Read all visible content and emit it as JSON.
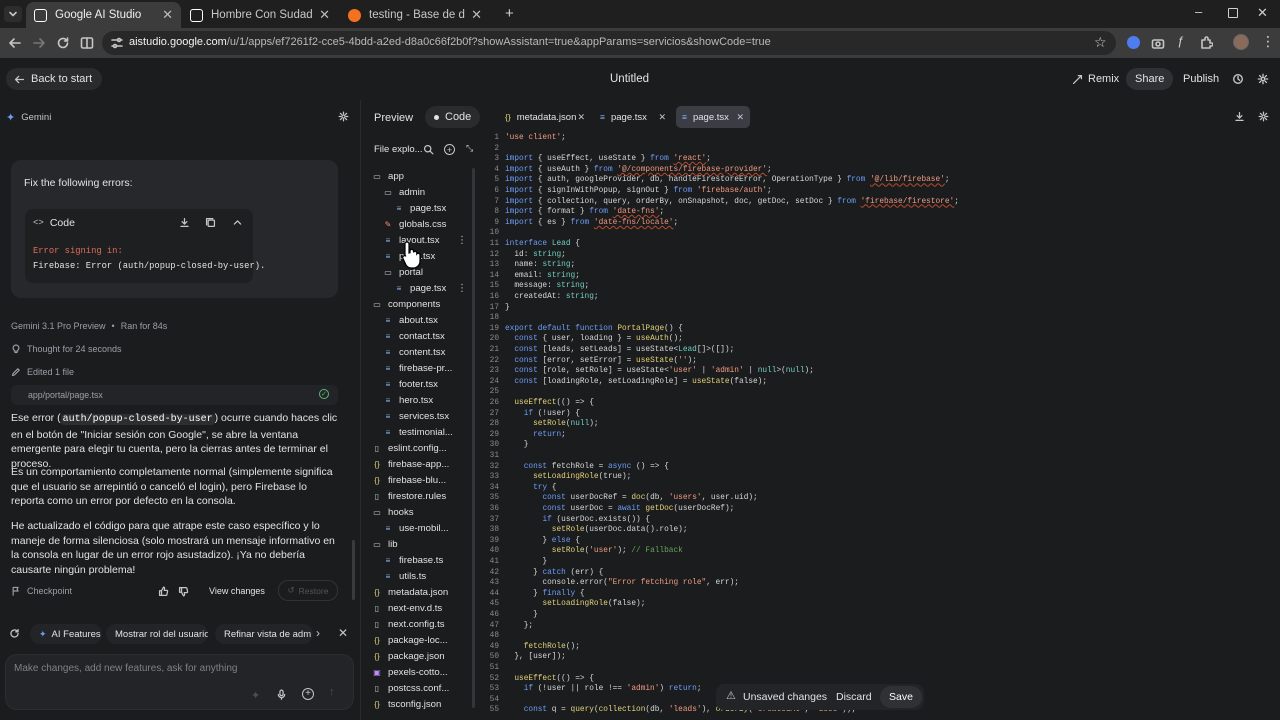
{
  "browser": {
    "tabs": [
      {
        "label": "Google AI Studio",
        "active": true
      },
      {
        "label": "Hombre Con Sudadera Negra |",
        "active": false
      },
      {
        "label": "testing - Base de datos - Datos",
        "active": false
      }
    ],
    "url_host": "aistudio.google.com",
    "url_path": "/u/1/apps/ef7261f2-cce5-4bdd-a2ed-d8a0c66f2b0f?showAssistant=true&appParams=servicios&showCode=true"
  },
  "header": {
    "back_label": "Back to start",
    "title": "Untitled",
    "remix_label": "Remix",
    "share_label": "Share",
    "publish_label": "Publish"
  },
  "assistant": {
    "name": "Gemini",
    "user_message": "Fix the following errors:",
    "code_card_title": "Code",
    "error_line1": "Error signing in:",
    "error_line2": "Firebase: Error (auth/popup-closed-by-user).",
    "model_label": "Gemini 3.1 Pro Preview",
    "ran_label": "Ran for 84s",
    "thought_label": "Thought for 24 seconds",
    "edited_label": "Edited 1 file",
    "edited_file": "app/portal/page.tsx",
    "p1_a": "Ese error (",
    "p1_code": "auth/popup-closed-by-user",
    "p1_b": ") ocurre cuando haces clic en el botón de \"Iniciar sesión con Google\", se abre la ventana emergente para elegir tu cuenta, pero la cierras antes de terminar el proceso.",
    "p2": "Es un comportamiento completamente normal (simplemente significa que el usuario se arrepintió o canceló el login), pero Firebase lo reporta como un error por defecto en la consola.",
    "p3": "He actualizado el código para que atrape este caso específico y lo maneje de forma silenciosa (solo mostrará un mensaje informativo en la consola en lugar de un error rojo asustadizo). ¡Ya no debería causarte ningún problema!",
    "checkpoint_label": "Checkpoint",
    "view_changes_label": "View changes",
    "restore_label": "Restore",
    "suggestions": [
      "AI Features",
      "Mostrar rol del usuario",
      "Refinar vista de adm"
    ],
    "input_placeholder": "Make changes, add new features, ask for anything"
  },
  "editor": {
    "preview_tab": "Preview",
    "code_tab": "Code",
    "file_tabs": [
      "metadata.json",
      "page.tsx",
      "page.tsx"
    ],
    "explorer_title": "File explo...",
    "files": [
      {
        "name": "app",
        "type": "folder",
        "depth": 0
      },
      {
        "name": "admin",
        "type": "folder",
        "depth": 1
      },
      {
        "name": "page.tsx",
        "type": "file",
        "depth": 2
      },
      {
        "name": "globals.css",
        "type": "css",
        "depth": 1
      },
      {
        "name": "layout.tsx",
        "type": "file",
        "depth": 1
      },
      {
        "name": "page.tsx",
        "type": "file",
        "depth": 1
      },
      {
        "name": "portal",
        "type": "folder",
        "depth": 1
      },
      {
        "name": "page.tsx",
        "type": "file",
        "depth": 2
      },
      {
        "name": "components",
        "type": "folder",
        "depth": 0
      },
      {
        "name": "about.tsx",
        "type": "file",
        "depth": 1
      },
      {
        "name": "contact.tsx",
        "type": "file",
        "depth": 1
      },
      {
        "name": "content.tsx",
        "type": "file",
        "depth": 1
      },
      {
        "name": "firebase-pr...",
        "type": "file",
        "depth": 1
      },
      {
        "name": "footer.tsx",
        "type": "file",
        "depth": 1
      },
      {
        "name": "hero.tsx",
        "type": "file",
        "depth": 1
      },
      {
        "name": "services.tsx",
        "type": "file",
        "depth": 1
      },
      {
        "name": "testimonial...",
        "type": "file",
        "depth": 1
      },
      {
        "name": "eslint.config...",
        "type": "page",
        "depth": 0
      },
      {
        "name": "firebase-app...",
        "type": "json",
        "depth": 0
      },
      {
        "name": "firebase-blu...",
        "type": "json",
        "depth": 0
      },
      {
        "name": "firestore.rules",
        "type": "page",
        "depth": 0
      },
      {
        "name": "hooks",
        "type": "folder",
        "depth": 0
      },
      {
        "name": "use-mobil...",
        "type": "file",
        "depth": 1
      },
      {
        "name": "lib",
        "type": "folder",
        "depth": 0
      },
      {
        "name": "firebase.ts",
        "type": "file",
        "depth": 1
      },
      {
        "name": "utils.ts",
        "type": "file",
        "depth": 1
      },
      {
        "name": "metadata.json",
        "type": "json",
        "depth": 0
      },
      {
        "name": "next-env.d.ts",
        "type": "page",
        "depth": 0
      },
      {
        "name": "next.config.ts",
        "type": "page",
        "depth": 0
      },
      {
        "name": "package-loc...",
        "type": "json",
        "depth": 0
      },
      {
        "name": "package.json",
        "type": "json",
        "depth": 0
      },
      {
        "name": "pexels-cotto...",
        "type": "image",
        "depth": 0
      },
      {
        "name": "postcss.conf...",
        "type": "page",
        "depth": 0
      },
      {
        "name": "tsconfig.json",
        "type": "json",
        "depth": 0
      }
    ],
    "code_lines": [
      "'use client';",
      "",
      "import { useEffect, useState } from 'react';",
      "import { useAuth } from '@/components/firebase-provider';",
      "import { auth, googleProvider, db, handleFirestoreError, OperationType } from '@/lib/firebase';",
      "import { signInWithPopup, signOut } from 'firebase/auth';",
      "import { collection, query, orderBy, onSnapshot, doc, getDoc, setDoc } from 'firebase/firestore';",
      "import { format } from 'date-fns';",
      "import { es } from 'date-fns/locale';",
      "",
      "interface Lead {",
      "  id: string;",
      "  name: string;",
      "  email: string;",
      "  message: string;",
      "  createdAt: string;",
      "}",
      "",
      "export default function PortalPage() {",
      "  const { user, loading } = useAuth();",
      "  const [leads, setLeads] = useState<Lead[]>([]);",
      "  const [error, setError] = useState('');",
      "  const [role, setRole] = useState<'user' | 'admin' | null>(null);",
      "  const [loadingRole, setLoadingRole] = useState(false);",
      "",
      "  useEffect(() => {",
      "    if (!user) {",
      "      setRole(null);",
      "      return;",
      "    }",
      "",
      "    const fetchRole = async () => {",
      "      setLoadingRole(true);",
      "      try {",
      "        const userDocRef = doc(db, 'users', user.uid);",
      "        const userDoc = await getDoc(userDocRef);",
      "        if (userDoc.exists()) {",
      "          setRole(userDoc.data().role);",
      "        } else {",
      "          setRole('user'); // Fallback",
      "        }",
      "      } catch (err) {",
      "        console.error(\"Error fetching role\", err);",
      "      } finally {",
      "        setLoadingRole(false);",
      "      }",
      "    };",
      "",
      "    fetchRole();",
      "  }, [user]);",
      "",
      "  useEffect(() => {",
      "    if (!user || role !== 'admin') return;",
      "",
      "    const q = query(collection(db, 'leads'), orderBy('createdAt', 'desc'));"
    ],
    "unsaved_label": "Unsaved changes",
    "discard_label": "Discard",
    "save_label": "Save"
  }
}
